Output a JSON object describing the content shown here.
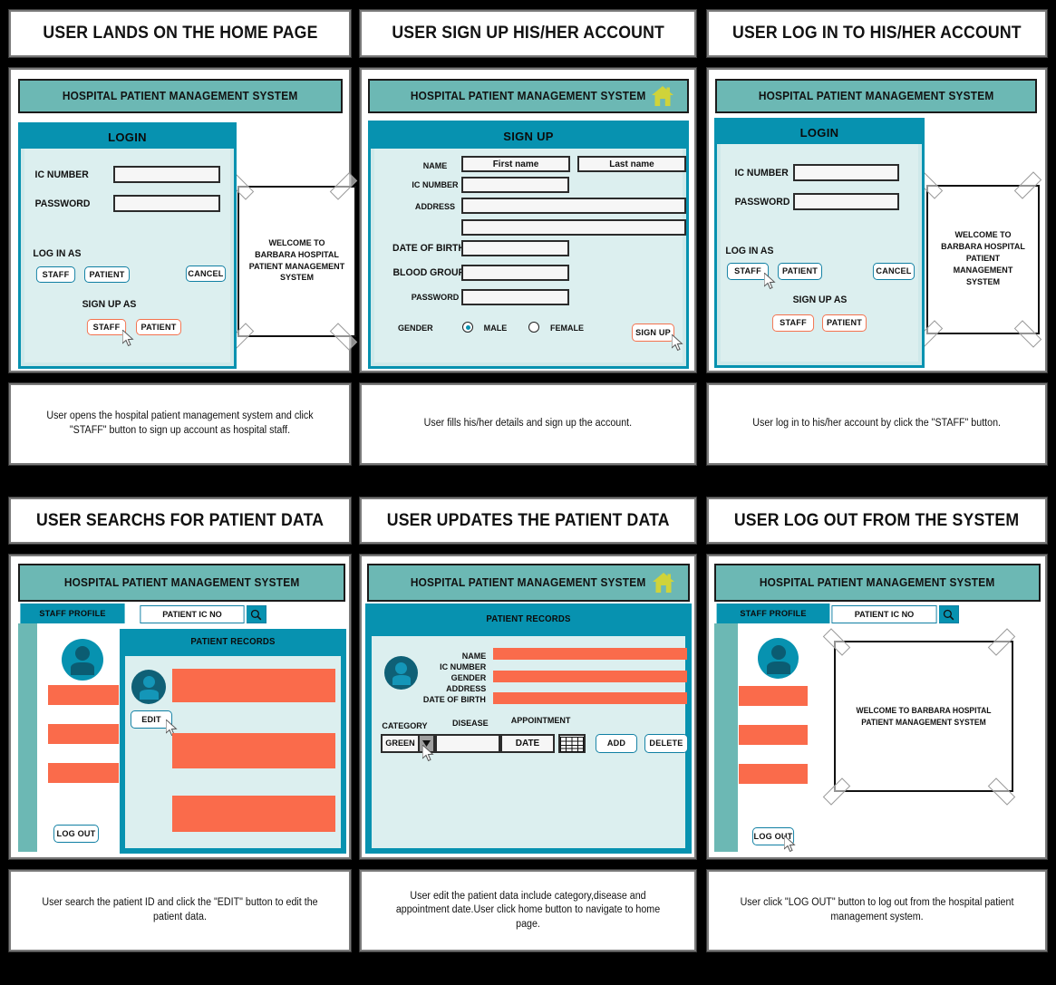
{
  "colors": {
    "appbar": "#6cb8b4",
    "accent": "#0792b0",
    "panel": "#dcefef",
    "orange": "#fa6b4b",
    "home_icon": "#cfd33a",
    "background": "#000000"
  },
  "app_title": "HOSPITAL PATIENT MANAGEMENT SYSTEM",
  "frames": [
    {
      "id": "home",
      "title": "USER LANDS ON THE HOME PAGE",
      "caption": "User opens the hospital patient management system and click \"STAFF\" button to sign up account as hospital staff.",
      "dialog_title": "LOGIN",
      "welcome_text": "WELCOME TO BARBARA HOSPITAL PATIENT MANAGEMENT SYSTEM"
    },
    {
      "id": "signup",
      "title": "USER SIGN UP HIS/HER ACCOUNT",
      "caption": "User fills his/her details and sign up the account.",
      "dialog_title": "SIGN UP"
    },
    {
      "id": "login",
      "title": "USER LOG IN TO HIS/HER ACCOUNT",
      "caption": "User log in to his/her account by click the \"STAFF\" button.",
      "dialog_title": "LOGIN",
      "welcome_text": "WELCOME TO BARBARA HOSPITAL PATIENT MANAGEMENT SYSTEM"
    },
    {
      "id": "search",
      "title": "USER SEARCHS FOR PATIENT DATA",
      "caption": "User search the patient ID and click the \"EDIT\" button to edit the patient data."
    },
    {
      "id": "update",
      "title": "USER UPDATES THE PATIENT DATA",
      "caption": "User edit the patient data include category,disease and appointment date.User click home button to navigate to home page."
    },
    {
      "id": "logout",
      "title": "USER LOG OUT FROM THE SYSTEM",
      "caption": "User click \"LOG OUT\" button to log out from the hospital patient management system.",
      "welcome_text": "WELCOME TO BARBARA HOSPITAL PATIENT MANAGEMENT SYSTEM"
    }
  ],
  "login_form": {
    "heading": "LOGIN",
    "ic_label": "IC NUMBER",
    "ic_value": "",
    "password_label": "PASSWORD",
    "password_value": "",
    "login_as_label": "LOG IN AS",
    "login_staff": "STAFF",
    "login_patient": "PATIENT",
    "cancel": "CANCEL",
    "signup_as_label": "SIGN UP AS",
    "signup_staff": "STAFF",
    "signup_patient": "PATIENT"
  },
  "signup_form": {
    "heading": "SIGN UP",
    "name_label": "NAME",
    "first_name_placeholder": "First name",
    "last_name_placeholder": "Last name",
    "ic_label": "IC NUMBER",
    "address_label": "ADDRESS",
    "dob_label": "DATE OF BIRTH",
    "blood_label": "BLOOD GROUP",
    "password_label": "PASSWORD",
    "gender_label": "GENDER",
    "gender_male": "MALE",
    "gender_female": "FEMALE",
    "gender_selected": "MALE",
    "submit": "SIGN UP"
  },
  "dashboard": {
    "profile_tab": "STAFF PROFILE",
    "search_placeholder": "PATIENT IC NO",
    "search_icon": "search-icon",
    "records_heading": "PATIENT RECORDS",
    "edit_button": "EDIT",
    "logout_button": "LOG OUT"
  },
  "record_form": {
    "heading": "PATIENT RECORDS",
    "fields": [
      "NAME",
      "IC NUMBER",
      "GENDER",
      "ADDRESS",
      "DATE OF BIRTH"
    ],
    "category_label": "CATEGORY",
    "category_value": "GREEN",
    "disease_label": "DISEASE",
    "disease_value": "",
    "appointment_label": "APPOINTMENT",
    "date_value": "DATE",
    "calendar_icon": "calendar-icon",
    "add_button": "ADD",
    "delete_button": "DELETE"
  }
}
